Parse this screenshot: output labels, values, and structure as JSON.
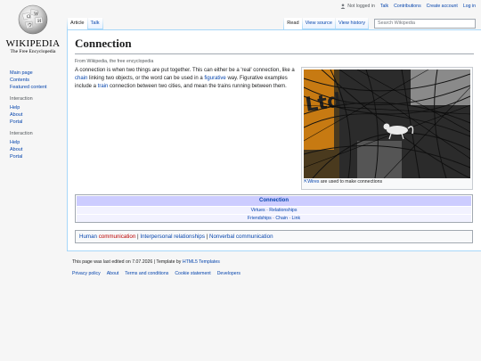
{
  "logo": {
    "wordmark": "WIKIPEDIA",
    "tagline": "The Free Encyclopedia"
  },
  "personal": {
    "not_logged_in": "Not logged in",
    "talk": "Talk",
    "contributions": "Contributions",
    "create_account": "Create account",
    "log_in": "Log in"
  },
  "tabs": {
    "article": "Article",
    "talk": "Talk",
    "read": "Read",
    "view_source": "View source",
    "view_history": "View history"
  },
  "search": {
    "placeholder": "Search Wikipedia"
  },
  "sidebar": {
    "main": [
      {
        "label": "Main page"
      },
      {
        "label": "Contents"
      },
      {
        "label": "Featured content"
      }
    ],
    "group1": {
      "heading": "Interaction",
      "items": [
        {
          "label": "Help"
        },
        {
          "label": "About"
        },
        {
          "label": "Portal"
        }
      ]
    },
    "group2": {
      "heading": "Interaction",
      "items": [
        {
          "label": "Help"
        },
        {
          "label": "About"
        },
        {
          "label": "Portal"
        }
      ]
    }
  },
  "article": {
    "title": "Connection",
    "subtitle": "From Wikipedia, the free encyclopedia",
    "p1": "A connection is when two things are put together. This can either be a 'real' connection, like a ",
    "link_chain": "chain",
    "p2": " linking two objects, or the word can be used in a ",
    "link_figurative": "figurative",
    "p3": " way. Figurative examples include a ",
    "link_train": "train",
    "p4": " connection between two cities, and mean the trains running between them."
  },
  "figure": {
    "caption_link": "Wires",
    "caption_text": " are used to make connections"
  },
  "navbox": {
    "title": "Connection",
    "row1": [
      "Virtues",
      "Relationships"
    ],
    "row2": [
      "Friendships",
      "Chain",
      "Link"
    ],
    "separator": " · "
  },
  "categories": {
    "c1a": "Human",
    "c1b": "communication",
    "c2": "Interpersonal relationships",
    "c3": "Nonverbal communication",
    "sep": " | "
  },
  "footer": {
    "edited": "This page was last edited on 7.07.2026",
    "template_by": " | Template by ",
    "template_link": "HTML5 Templates",
    "links": [
      "Privacy policy",
      "About",
      "Terms and conditions",
      "Cookie statement",
      "Developers"
    ]
  },
  "colors": {
    "link": "#0645ad",
    "redlink": "#ba0000",
    "navbox_title": "#ccccff",
    "navbox_row": "#f2f2ff"
  }
}
